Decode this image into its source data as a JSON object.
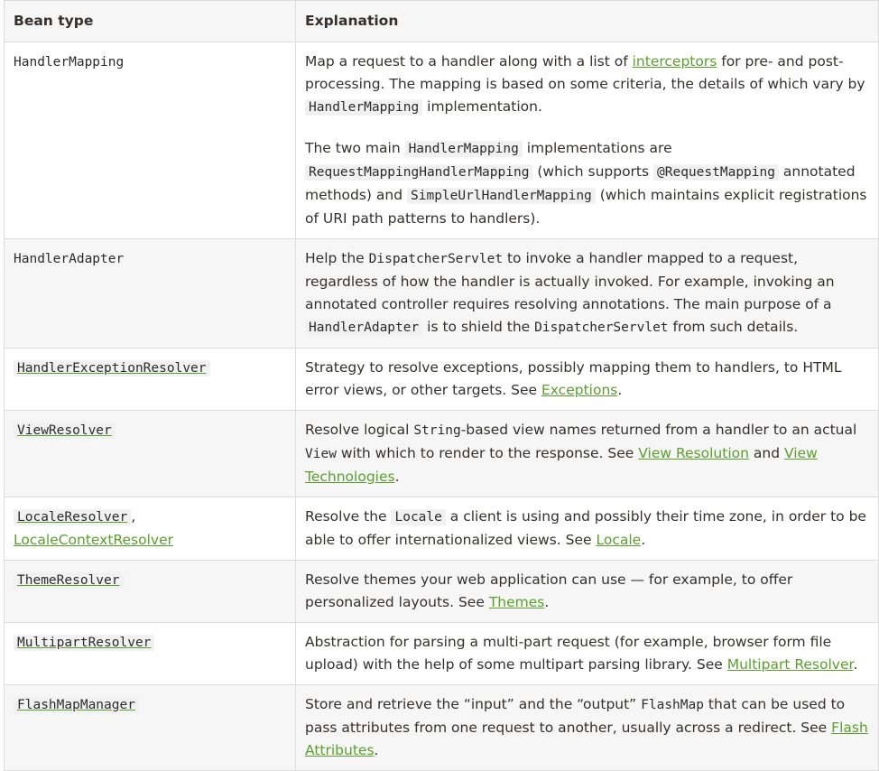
{
  "header": {
    "col1": "Bean type",
    "col2": "Explanation"
  },
  "rows": [
    {
      "type": "HandlerMapping",
      "p1": {
        "t1": "Map a request to a handler along with a list of ",
        "link": "interceptors",
        "t2": " for pre- and post-processing. The mapping is based on some criteria, the details of which vary by ",
        "code": "HandlerMapping",
        "t3": " implementation."
      },
      "p2": {
        "t1": "The two main ",
        "code1": "HandlerMapping",
        "t2": " implementations are ",
        "code2": "RequestMappingHandlerMapping",
        "t3": " (which supports ",
        "code3": "@RequestMapping",
        "t4": " annotated methods) and ",
        "code4": "SimpleUrlHandlerMapping",
        "t5": " (which maintains explicit registrations of URI path patterns to handlers)."
      }
    },
    {
      "type": "HandlerAdapter",
      "t1": "Help the ",
      "code1": "DispatcherServlet",
      "t2": " to invoke a handler mapped to a request, regardless of how the handler is actually invoked. For example, invoking an annotated controller requires resolving annotations. The main purpose of a ",
      "code2": "HandlerAdapter",
      "t3": " is to shield the ",
      "code3": "DispatcherServlet",
      "t4": " from such details."
    },
    {
      "type": "HandlerExceptionResolver",
      "t1": "Strategy to resolve exceptions, possibly mapping them to handlers, to HTML error views, or other targets. See ",
      "link": "Exceptions",
      "t2": "."
    },
    {
      "type": "ViewResolver",
      "t1": "Resolve logical ",
      "code1": "String",
      "t2": "-based view names returned from a handler to an actual ",
      "code2": "View",
      "t3": " with which to render to the response. See ",
      "link1": "View Resolution",
      "t4": " and ",
      "link2": "View Technologies",
      "t5": "."
    },
    {
      "type": "LocaleResolver",
      "sep": ", ",
      "type2": "LocaleContextResolver",
      "t1": "Resolve the ",
      "code1": "Locale",
      "t2": " a client is using and possibly their time zone, in order to be able to offer internationalized views. See ",
      "link": "Locale",
      "t3": "."
    },
    {
      "type": "ThemeResolver",
      "t1": "Resolve themes your web application can use — for example, to offer personalized layouts. See ",
      "link": "Themes",
      "t2": "."
    },
    {
      "type": "MultipartResolver",
      "t1": "Abstraction for parsing a multi-part request (for example, browser form file upload) with the help of some multipart parsing library. See ",
      "link": "Multipart Resolver",
      "t2": "."
    },
    {
      "type": "FlashMapManager",
      "t1": "Store and retrieve the “input” and the “output” ",
      "code1": "FlashMap",
      "t2": " that can be used to pass attributes from one request to another, usually across a redirect. See ",
      "link": "Flash Attributes",
      "t3": "."
    }
  ],
  "colors": {
    "link": "#5aa02c",
    "text": "#34302d",
    "stripe": "#f6f6f6",
    "border": "#dcdcdc"
  }
}
